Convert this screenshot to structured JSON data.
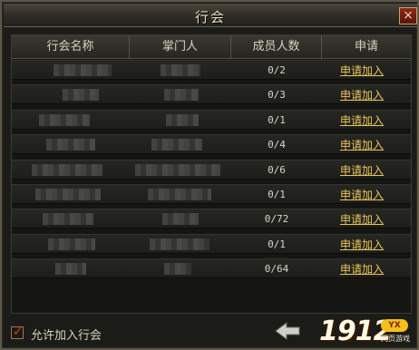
{
  "window": {
    "title": "行会",
    "close_icon": "×"
  },
  "table": {
    "columns": [
      "行会名称",
      "掌门人",
      "成员人数",
      "申请"
    ],
    "rows": [
      {
        "members": "0/2",
        "action": "申请加入"
      },
      {
        "members": "0/3",
        "action": "申请加入"
      },
      {
        "members": "0/1",
        "action": "申请加入"
      },
      {
        "members": "0/4",
        "action": "申请加入"
      },
      {
        "members": "0/6",
        "action": "申请加入"
      },
      {
        "members": "0/1",
        "action": "申请加入"
      },
      {
        "members": "0/72",
        "action": "申请加入"
      },
      {
        "members": "0/1",
        "action": "申请加入"
      },
      {
        "members": "0/64",
        "action": "申请加入"
      }
    ]
  },
  "footer": {
    "allow_join_label": "允许加入行会",
    "allow_join_checked": true,
    "back_icon": "left-arrow-icon"
  },
  "watermark": {
    "digits": "1912",
    "badge": "YX",
    "subtitle": "网页游戏"
  }
}
